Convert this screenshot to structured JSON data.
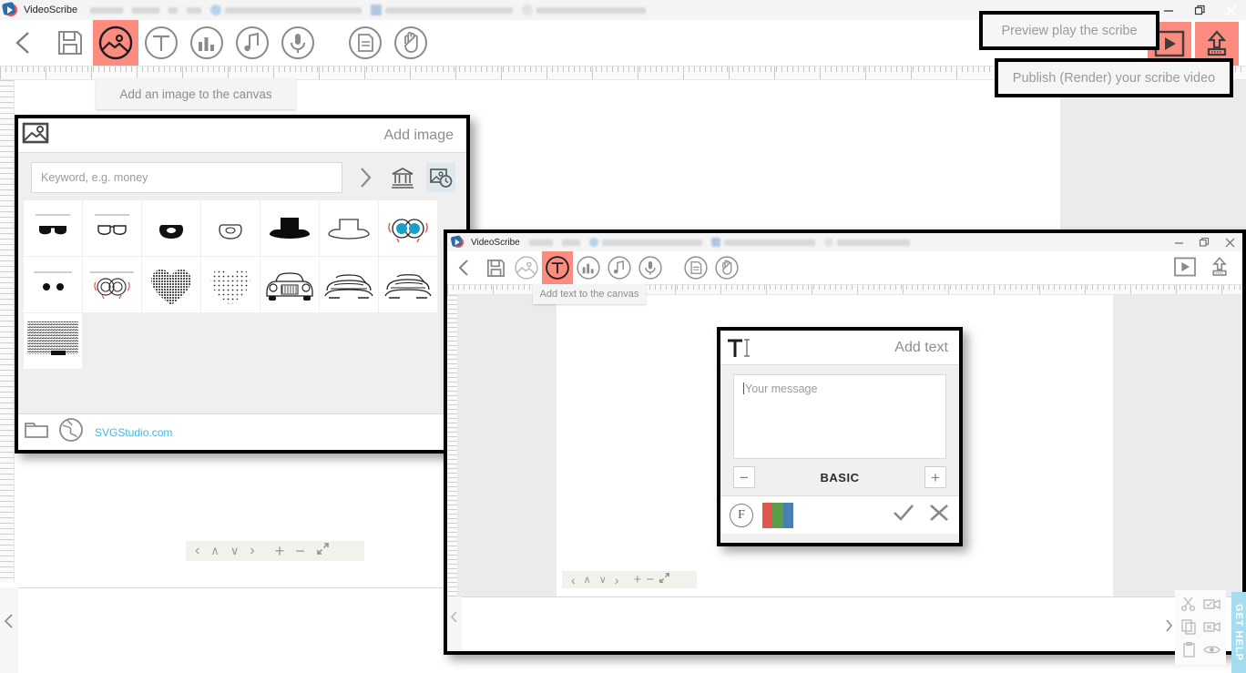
{
  "window1": {
    "title": "VideoScribe",
    "ghost_tabs": [
      "pages",
      "demo",
      "x",
      "1.1",
      "Teach 101 - Your Daily Dashb...",
      "VideoScribe: Changing...",
      "Google precursos"
    ],
    "controls": {
      "minimize": "minimize-icon",
      "maximize": "maximize-icon",
      "close": "close-icon"
    },
    "toolbar": [
      {
        "name": "back",
        "icon": "chevron-left-icon",
        "selected": false
      },
      {
        "name": "save",
        "icon": "floppy-save-icon",
        "selected": false
      },
      {
        "name": "add-image",
        "icon": "image-circle-icon",
        "selected": true
      },
      {
        "name": "add-text",
        "icon": "text-circle-icon",
        "selected": false
      },
      {
        "name": "add-chart",
        "icon": "chart-circle-icon",
        "selected": false
      },
      {
        "name": "add-music",
        "icon": "music-note-circle-icon",
        "selected": false
      },
      {
        "name": "add-voiceover",
        "icon": "microphone-circle-icon",
        "selected": false
      },
      {
        "name": "paper-style",
        "icon": "paper-circle-icon",
        "selected": false
      },
      {
        "name": "hand-style",
        "icon": "hand-circle-icon",
        "selected": false
      }
    ],
    "right_actions": [
      {
        "name": "preview-play",
        "icon": "play-button-icon",
        "highlight": "#fc8b80"
      },
      {
        "name": "publish-render",
        "icon": "upload-share-icon",
        "highlight": "#fc8b80"
      }
    ],
    "tooltips": {
      "add_image": "Add an image to the canvas",
      "preview": "Preview play the scribe",
      "publish": "Publish (Render) your scribe video"
    },
    "bottom_nav": {
      "prev": "‹",
      "up": "∧",
      "down": "∨",
      "next": "›",
      "zoom_in": "+",
      "zoom_out": "−",
      "fit": "expand-arrows-icon"
    }
  },
  "add_image_panel": {
    "icon": "image-frame-icon",
    "title": "Add image",
    "search": {
      "placeholder": "Keyword, e.g. money",
      "value": ""
    },
    "go_label": "›",
    "sources": [
      {
        "name": "library-museum",
        "icon": "museum-bank-icon",
        "active": false
      },
      {
        "name": "recent-images",
        "icon": "image-clock-icon",
        "active": true
      }
    ],
    "thumbnails": [
      {
        "name": "sunglasses-filled",
        "kind": "sunglasses-solid"
      },
      {
        "name": "sunglasses-outline",
        "kind": "sunglasses-outline"
      },
      {
        "name": "mask-filled",
        "kind": "mask-solid"
      },
      {
        "name": "mask-outline",
        "kind": "mask-outline"
      },
      {
        "name": "hat-filled",
        "kind": "hat-solid"
      },
      {
        "name": "hat-outline",
        "kind": "hat-outline"
      },
      {
        "name": "eyes-colored",
        "kind": "eyes-color"
      },
      {
        "name": "two-dots",
        "kind": "two-dots"
      },
      {
        "name": "eyes-outline",
        "kind": "eyes-outline"
      },
      {
        "name": "heart-dense",
        "kind": "heart-dense"
      },
      {
        "name": "heart-sparse",
        "kind": "heart-sparse"
      },
      {
        "name": "classic-car",
        "kind": "car-classic"
      },
      {
        "name": "sports-car-a",
        "kind": "car-sport"
      },
      {
        "name": "sports-car-b",
        "kind": "car-sport2"
      },
      {
        "name": "crowd-scribble",
        "kind": "scribble"
      }
    ],
    "footer": {
      "folder_icon": "folder-icon",
      "globe_icon": "globe-icon",
      "link": "SVGStudio.com",
      "next_icon": "chevron-right-icon"
    }
  },
  "window2": {
    "title": "VideoScribe",
    "controls": {
      "minimize": "minimize-icon",
      "maximize": "maximize-icon",
      "close": "close-icon"
    },
    "toolbar": [
      {
        "name": "back",
        "icon": "chevron-left-icon",
        "selected": false
      },
      {
        "name": "save",
        "icon": "floppy-save-icon",
        "selected": false
      },
      {
        "name": "add-image",
        "icon": "image-circle-icon",
        "selected": false
      },
      {
        "name": "add-text",
        "icon": "text-circle-icon",
        "selected": true
      },
      {
        "name": "add-chart",
        "icon": "chart-circle-icon",
        "selected": false
      },
      {
        "name": "add-music",
        "icon": "music-note-circle-icon",
        "selected": false
      },
      {
        "name": "add-voiceover",
        "icon": "microphone-circle-icon",
        "selected": false
      },
      {
        "name": "paper-style",
        "icon": "paper-circle-icon",
        "selected": false
      },
      {
        "name": "hand-style",
        "icon": "hand-circle-icon",
        "selected": false
      }
    ],
    "right_actions": [
      {
        "name": "preview-play",
        "icon": "play-button-icon"
      },
      {
        "name": "publish-render",
        "icon": "upload-share-icon"
      }
    ],
    "tooltips": {
      "add_text": "Add text to the canvas"
    },
    "bottom_nav": {
      "prev": "‹",
      "up": "∧",
      "down": "∨",
      "next": "›",
      "zoom_in": "+",
      "zoom_out": "−",
      "fit": "expand-arrows-icon"
    }
  },
  "add_text_dialog": {
    "icon": "text-cursor-icon",
    "title": "Add text",
    "message": {
      "placeholder": "Your message",
      "value": ""
    },
    "font": {
      "decrease": "−",
      "name": "BASIC",
      "increase": "+"
    },
    "footer": {
      "font_picker": "F",
      "color_swatch": [
        "#e2574c",
        "#5a9e4a",
        "#4a7fb5"
      ],
      "confirm": "check-icon",
      "cancel": "x-icon"
    }
  },
  "tool_palette": {
    "items": [
      {
        "name": "cut",
        "icon": "scissors-icon"
      },
      {
        "name": "camera-show",
        "icon": "camera-check-icon"
      },
      {
        "name": "copy",
        "icon": "copy-icon"
      },
      {
        "name": "camera-remove",
        "icon": "camera-x-icon"
      },
      {
        "name": "paste",
        "icon": "clipboard-icon"
      },
      {
        "name": "visibility",
        "icon": "eye-icon"
      }
    ],
    "expand": "chevron-right-icon"
  },
  "get_help": {
    "label": "GET HELP"
  }
}
